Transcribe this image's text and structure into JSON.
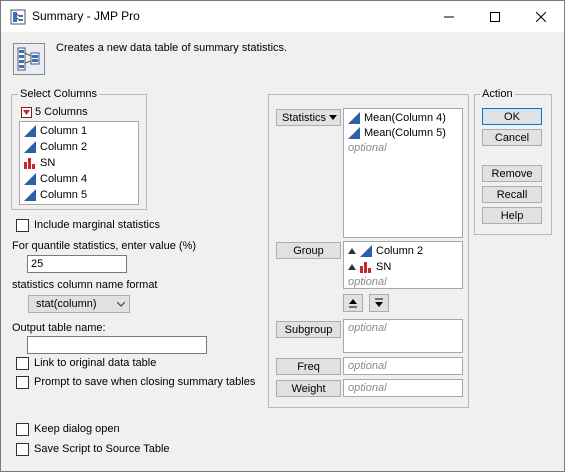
{
  "window": {
    "title": "Summary - JMP Pro",
    "description": "Creates a new data table of summary statistics."
  },
  "select_columns": {
    "title": "Select Columns",
    "count_label": "5 Columns",
    "items": [
      {
        "label": "Column 1",
        "icon": "continuous-icon"
      },
      {
        "label": "Column 2",
        "icon": "continuous-icon"
      },
      {
        "label": "SN",
        "icon": "nominal-icon"
      },
      {
        "label": "Column 4",
        "icon": "continuous-icon"
      },
      {
        "label": "Column 5",
        "icon": "continuous-icon"
      }
    ]
  },
  "options": {
    "include_marginal": "Include marginal statistics",
    "quantile_label": "For quantile statistics, enter value (%)",
    "quantile_value": "25",
    "colname_format_label": "statistics column name format",
    "colname_format_value": "stat(column)",
    "output_name_label": "Output table name:",
    "output_name_value": "",
    "link_label": "Link to original data table",
    "prompt_label": "Prompt to save when closing summary tables",
    "keep_open_label": "Keep dialog open",
    "save_script_label": "Save Script to Source Table"
  },
  "roles": {
    "statistics_label": "Statistics",
    "statistics_items": [
      "Mean(Column 4)",
      "Mean(Column 5)"
    ],
    "group_label": "Group",
    "group_items": [
      "Column 2",
      "SN"
    ],
    "subgroup_label": "Subgroup",
    "freq_label": "Freq",
    "weight_label": "Weight",
    "optional": "optional"
  },
  "action": {
    "title": "Action",
    "ok": "OK",
    "cancel": "Cancel",
    "remove": "Remove",
    "recall": "Recall",
    "help": "Help"
  },
  "colors": {
    "continuous_blue": "#2d5fa8",
    "nominal_red": "#c62828",
    "focus_border": "#0078d7"
  }
}
